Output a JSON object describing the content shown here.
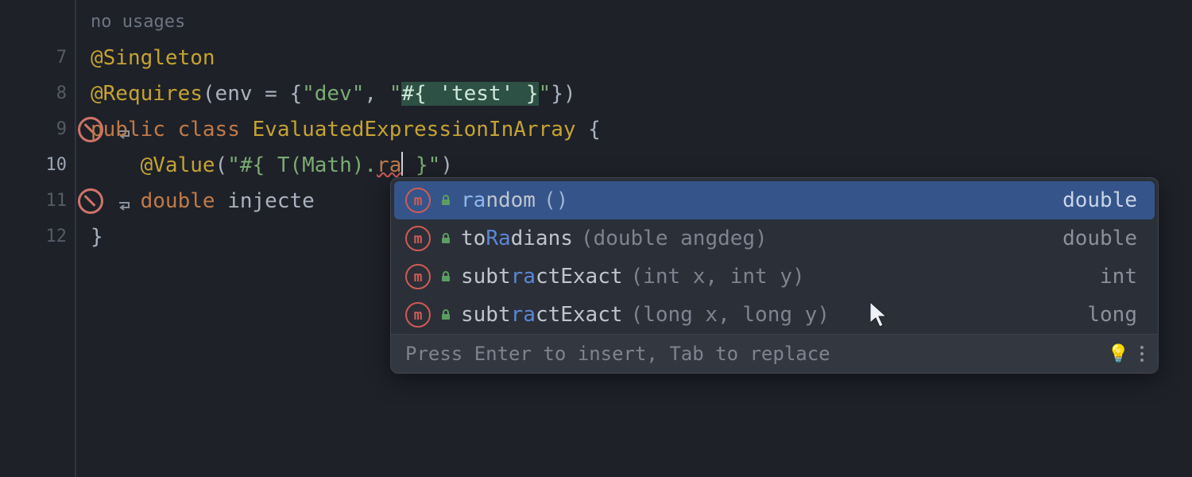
{
  "gutter": {
    "l6": "",
    "l7": "7",
    "l8": "8",
    "l9": "9",
    "l10": "10",
    "l11": "11",
    "l12": "12"
  },
  "code": {
    "inlay_no_usages": "no usages",
    "ann_singleton": "@Singleton",
    "ann_requires": "@Requires",
    "requires_open": "(env = {",
    "str_dev": "\"dev\"",
    "comma_space": ", ",
    "str_q_open": "\"",
    "sel_text": "#{ 'test' }",
    "str_q_close": "\"",
    "requires_close": "})",
    "kw_public": "public",
    "kw_class": "class",
    "cls_name": "EvaluatedExpressionInArray",
    "brace_open": " {",
    "indent1": "    ",
    "ann_value": "@Value",
    "value_open": "(",
    "value_str_pre": "\"#{ T(Math).",
    "value_typed": "ra",
    "value_str_post": " }\"",
    "value_close": ")",
    "kw_double": "double",
    "ident_injected": " injecte",
    "brace_close": "}"
  },
  "popup": {
    "items": [
      {
        "before": "",
        "match": "ra",
        "after": "ndom",
        "params": "()",
        "ret": "double"
      },
      {
        "before": "to",
        "match": "Ra",
        "after": "dians",
        "params": "(double angdeg)",
        "ret": "double"
      },
      {
        "before": "subt",
        "match": "ra",
        "after": "ctExact",
        "params": "(int x, int y)",
        "ret": "int"
      },
      {
        "before": "subt",
        "match": "ra",
        "after": "ctExact",
        "params": "(long x, long y)",
        "ret": "long"
      }
    ],
    "hint": "Press Enter to insert, Tab to replace"
  }
}
